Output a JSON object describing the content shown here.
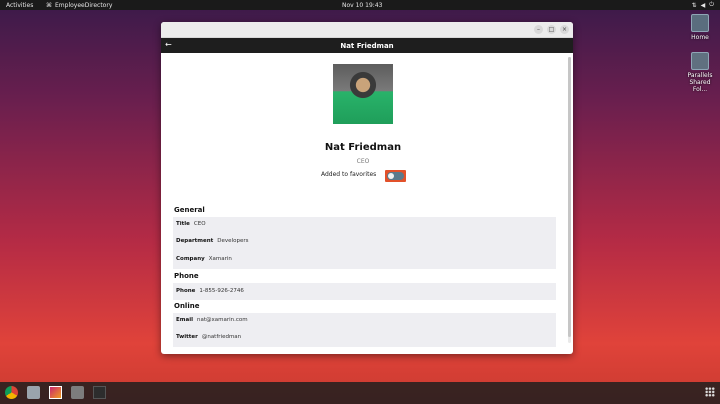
{
  "topbar": {
    "activities": "Activities",
    "app_name": "EmployeeDirectory",
    "clock": "Nov 10  19:43"
  },
  "desktop": {
    "icons": [
      {
        "label": "Home"
      },
      {
        "label": "Parallels Shared Fol..."
      }
    ]
  },
  "window": {
    "controls": {
      "minimize": "–",
      "maximize": "□",
      "close": "×"
    },
    "nav": {
      "back": "←",
      "title": "Nat Friedman"
    }
  },
  "profile": {
    "name": "Nat Friedman",
    "role": "CEO",
    "favorite_label": "Added to favorites",
    "favorite_on": true
  },
  "sections": {
    "general": {
      "title": "General",
      "rows": [
        {
          "key": "Title",
          "value": "CEO"
        },
        {
          "key": "Department",
          "value": "Developers"
        },
        {
          "key": "Company",
          "value": "Xamarin"
        }
      ]
    },
    "phone": {
      "title": "Phone",
      "rows": [
        {
          "key": "Phone",
          "value": "1-855-926-2746"
        }
      ]
    },
    "online": {
      "title": "Online",
      "rows": [
        {
          "key": "Email",
          "value": "nat@xamarin.com"
        },
        {
          "key": "Twitter",
          "value": "@natfriedman"
        }
      ]
    }
  },
  "colors": {
    "toggle_accent": "#e2512a",
    "nav_bg": "#1e1e1e"
  }
}
